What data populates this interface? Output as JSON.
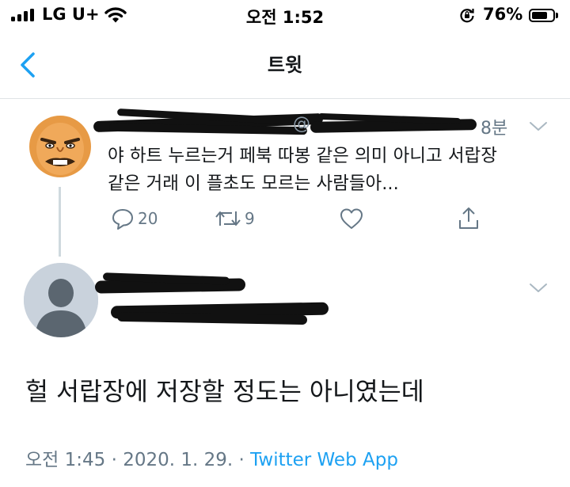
{
  "status_bar": {
    "carrier": "LG U+",
    "time": "오전 1:52",
    "battery_percent": "76%",
    "battery_level": 0.76
  },
  "nav": {
    "title": "트윗"
  },
  "parent_tweet": {
    "handle_visible": "@",
    "time_ago": "8분",
    "text_line1": "야 하트 누르는거 페북 따봉 같은 의미 아니고 서랍장",
    "text_line2": "같은 거래 이 플초도 모르는 사람들아...",
    "reply_count": "20",
    "retweet_count": "9"
  },
  "main_tweet": {
    "text": "헐 서랍장에 저장할 정도는 아니였는데",
    "timestamp": "오전 1:45 · 2020. 1. 29. · ",
    "source": "Twitter Web App"
  },
  "colors": {
    "accent": "#1da1f2",
    "secondary_text": "#657786",
    "divider": "#dfe3e6"
  },
  "icons": [
    "signal-icon",
    "wifi-icon",
    "rotation-lock-icon",
    "battery-icon",
    "back-chevron-icon",
    "chevron-down-icon",
    "reply-icon",
    "retweet-icon",
    "like-icon",
    "share-icon",
    "avatar-placeholder-icon"
  ]
}
